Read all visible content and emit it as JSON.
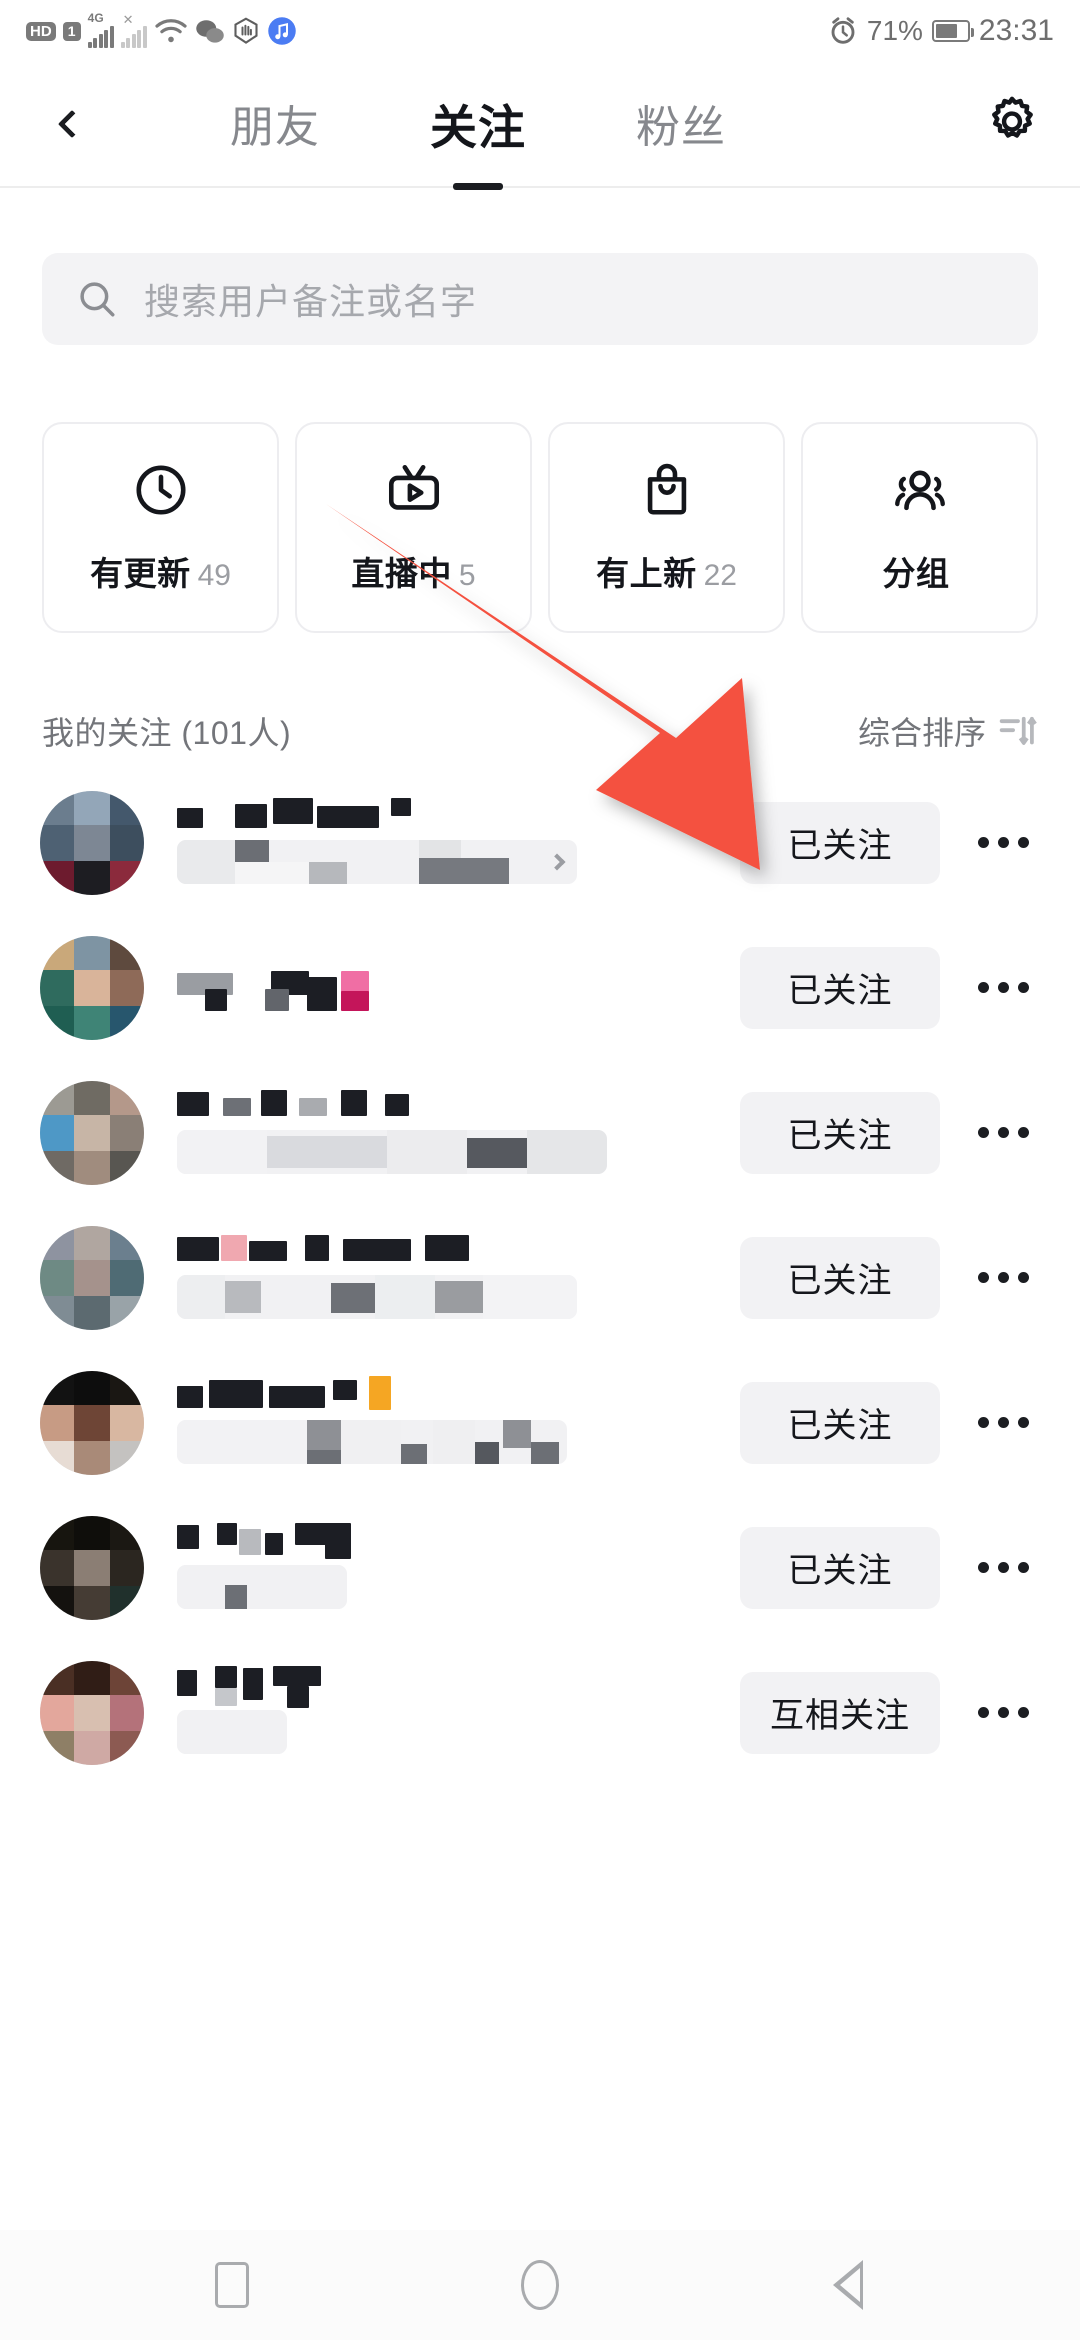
{
  "status_bar": {
    "hd_badge": "HD",
    "sim_badge": "1",
    "network_label": "4G",
    "battery_percent": "71%",
    "time": "23:31",
    "icons": [
      "hd-badge",
      "sim-card-icon",
      "signal-4g-icon",
      "signal-no-service-icon",
      "wifi-icon",
      "wechat-icon",
      "hand-icon",
      "music-icon",
      "alarm-icon",
      "battery-icon"
    ]
  },
  "topnav": {
    "back_icon": "chevron-left-icon",
    "settings_icon": "gear-icon",
    "tabs": [
      {
        "label": "朋友",
        "active": false
      },
      {
        "label": "关注",
        "active": true
      },
      {
        "label": "粉丝",
        "active": false
      }
    ]
  },
  "search": {
    "icon": "search-icon",
    "placeholder": "搜索用户备注或名字",
    "value": ""
  },
  "quick_cards": [
    {
      "icon": "clock-icon",
      "label": "有更新",
      "count": "49"
    },
    {
      "icon": "live-tv-icon",
      "label": "直播中",
      "count": "5"
    },
    {
      "icon": "shopping-bag-icon",
      "label": "有上新",
      "count": "22"
    },
    {
      "icon": "group-people-icon",
      "label": "分组",
      "count": ""
    }
  ],
  "list_header": {
    "title": "我的关注 (101人)",
    "sort_label": "综合排序",
    "sort_icon": "sort-icon"
  },
  "user_rows": [
    {
      "follow_label": "已关注",
      "more_icon": "more-dots-icon",
      "has_subtitle": true
    },
    {
      "follow_label": "已关注",
      "more_icon": "more-dots-icon",
      "has_subtitle": false
    },
    {
      "follow_label": "已关注",
      "more_icon": "more-dots-icon",
      "has_subtitle": true
    },
    {
      "follow_label": "已关注",
      "more_icon": "more-dots-icon",
      "has_subtitle": true
    },
    {
      "follow_label": "已关注",
      "more_icon": "more-dots-icon",
      "has_subtitle": true
    },
    {
      "follow_label": "已关注",
      "more_icon": "more-dots-icon",
      "has_subtitle": true
    },
    {
      "follow_label": "互相关注",
      "more_icon": "more-dots-icon",
      "has_subtitle": true
    }
  ],
  "annotation": {
    "type": "arrow",
    "color": "#F4513F",
    "points_to": "已关注"
  },
  "bottom_nav": {
    "items": [
      {
        "icon": "recents-square-icon"
      },
      {
        "icon": "home-circle-icon"
      },
      {
        "icon": "back-triangle-icon"
      }
    ]
  }
}
